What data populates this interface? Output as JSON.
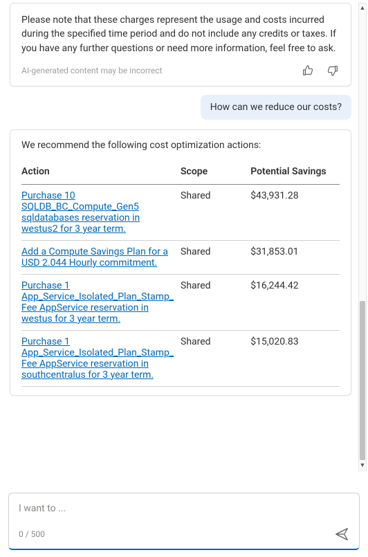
{
  "assistant1": {
    "text": "Please note that these charges represent the usage and costs incurred during the specified time period and do not include any credits or taxes. If you have any further questions or need more information, feel free to ask.",
    "disclaimer": "AI-generated content may be incorrect"
  },
  "user1": {
    "text": "How can we reduce our costs?"
  },
  "assistant2": {
    "intro": "We recommend the following cost optimization actions:",
    "table": {
      "headers": {
        "action": "Action",
        "scope": "Scope",
        "savings": "Potential Savings"
      },
      "rows": [
        {
          "action": "Purchase 10 SQLDB_BC_Compute_Gen5 sqldatabases reservation in westus2 for 3 year term.",
          "scope": "Shared",
          "savings": "$43,931.28"
        },
        {
          "action": "Add a Compute Savings Plan for a USD 2.044 Hourly commitment.",
          "scope": "Shared",
          "savings": "$31,853.01"
        },
        {
          "action": "Purchase 1 App_Service_Isolated_Plan_Stamp_Fee AppService reservation in westus for 3 year term.",
          "scope": "Shared",
          "savings": "$16,244.42"
        },
        {
          "action": "Purchase 1 App_Service_Isolated_Plan_Stamp_Fee AppService reservation in southcentralus for 3 year term.",
          "scope": "Shared",
          "savings": "$15,020.83"
        }
      ]
    }
  },
  "input": {
    "placeholder": "I want to ...",
    "charCount": "0 / 500"
  }
}
